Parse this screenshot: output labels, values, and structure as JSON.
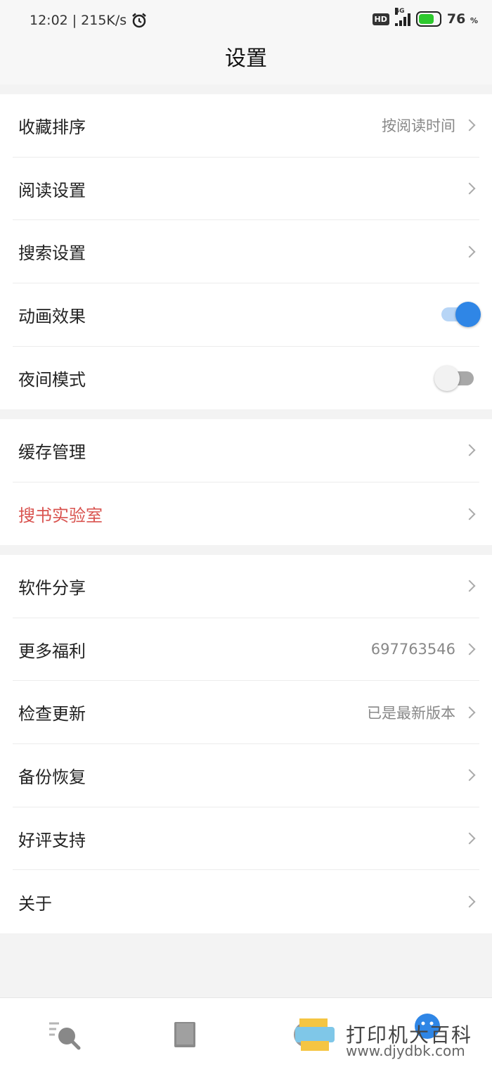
{
  "status_bar": {
    "time": "12:02",
    "net_speed": "215K/s",
    "hd": "HD",
    "network": "4G",
    "battery": "76",
    "battery_unit": "%",
    "battery_color": "#2ec92e"
  },
  "header": {
    "title": "设置"
  },
  "group1": {
    "items": [
      {
        "label": "收藏排序",
        "value": "按阅读时间"
      },
      {
        "label": "阅读设置"
      },
      {
        "label": "搜索设置"
      },
      {
        "label": "动画效果",
        "toggle": true
      },
      {
        "label": "夜间模式",
        "toggle": false
      }
    ]
  },
  "group2": {
    "items": [
      {
        "label": "缓存管理"
      },
      {
        "label": "搜书实验室",
        "color": "#d9534f"
      }
    ]
  },
  "group3": {
    "items": [
      {
        "label": "软件分享"
      },
      {
        "label": "更多福利",
        "value": "697763546"
      },
      {
        "label": "检查更新",
        "value": "已是最新版本"
      },
      {
        "label": "备份恢复"
      },
      {
        "label": "好评支持"
      },
      {
        "label": "关于"
      }
    ]
  },
  "bottom_nav": {
    "items": [
      {
        "icon": "search-list-icon"
      },
      {
        "icon": "book-icon"
      },
      {
        "icon": "discover-icon"
      },
      {
        "icon": "profile-icon"
      }
    ]
  },
  "watermark": {
    "text": "打印机大百科",
    "url": "www.djydbk.com"
  },
  "colors": {
    "accent": "#2f86e6",
    "danger": "#d9534f"
  }
}
